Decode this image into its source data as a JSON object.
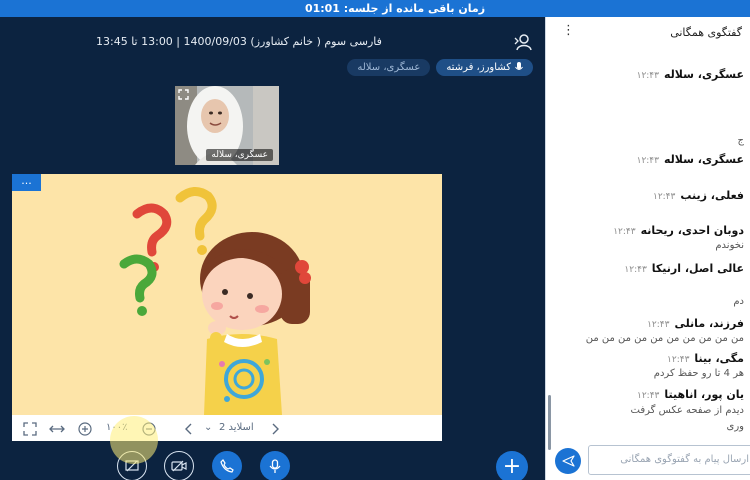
{
  "top_bar": {
    "text": "زمان باقی مانده از جلسه: 01:01"
  },
  "meeting": {
    "title": "فارسی سوم ( خانم کشاورز) 1400/09/03 | 13:00 تا 13:45"
  },
  "talking": [
    {
      "name": "کشاورز، فرشته",
      "state": "active"
    },
    {
      "name": "عسگری، سلاله",
      "state": "muted"
    }
  ],
  "webcam": {
    "name": "عسگری، سلاله"
  },
  "slide": {
    "menu_label": "...",
    "slide_label": "اسلاید 2",
    "zoom": "۱۰۰٪"
  },
  "chat": {
    "header": "گفتگوی همگانی",
    "messages": [
      {
        "name": "عسگری، سلاله",
        "time": "۱۲:۴۳"
      },
      {
        "name": "عسگری، سلاله",
        "time": "۱۲:۴۳"
      },
      {
        "name": "فعلی، زینب",
        "time": "۱۲:۴۳"
      },
      {
        "name": "دوبان احدی، ریحانه",
        "time": "۱۲:۴۳",
        "text": "نخوندم"
      },
      {
        "name": "عالی اصل، ارنیکا",
        "time": "۱۲:۴۳"
      },
      {
        "name": "فرزند، مانلی",
        "time": "۱۲:۴۳",
        "text": "من من من من من من من من من من"
      },
      {
        "name": "مگی، بینا",
        "time": "۱۲:۴۳",
        "text": "هر 4 تا رو حفظ کردم"
      },
      {
        "name": "یان پور، اناهیتا",
        "time": "۱۲:۴۳",
        "text": "دیدم از صفحه عکس گرفت"
      }
    ],
    "fragments": [
      "ج",
      "دم",
      "وری"
    ],
    "input_placeholder": "ارسال پیام به گفتوگوی همگانی"
  },
  "colors": {
    "accent": "#1b73d4",
    "dark_bg": "#0c2340",
    "slide_bg": "#fde4a8"
  },
  "icons": [
    "user-icon",
    "mic-icon",
    "fullscreen-icon",
    "fit-width-icon",
    "zoom-in-icon",
    "zoom-out-icon",
    "prev-slide-icon",
    "next-slide-icon",
    "screen-share-off-icon",
    "camera-off-icon",
    "phone-icon",
    "microphone-icon",
    "plus-icon",
    "send-icon",
    "more-icon"
  ]
}
